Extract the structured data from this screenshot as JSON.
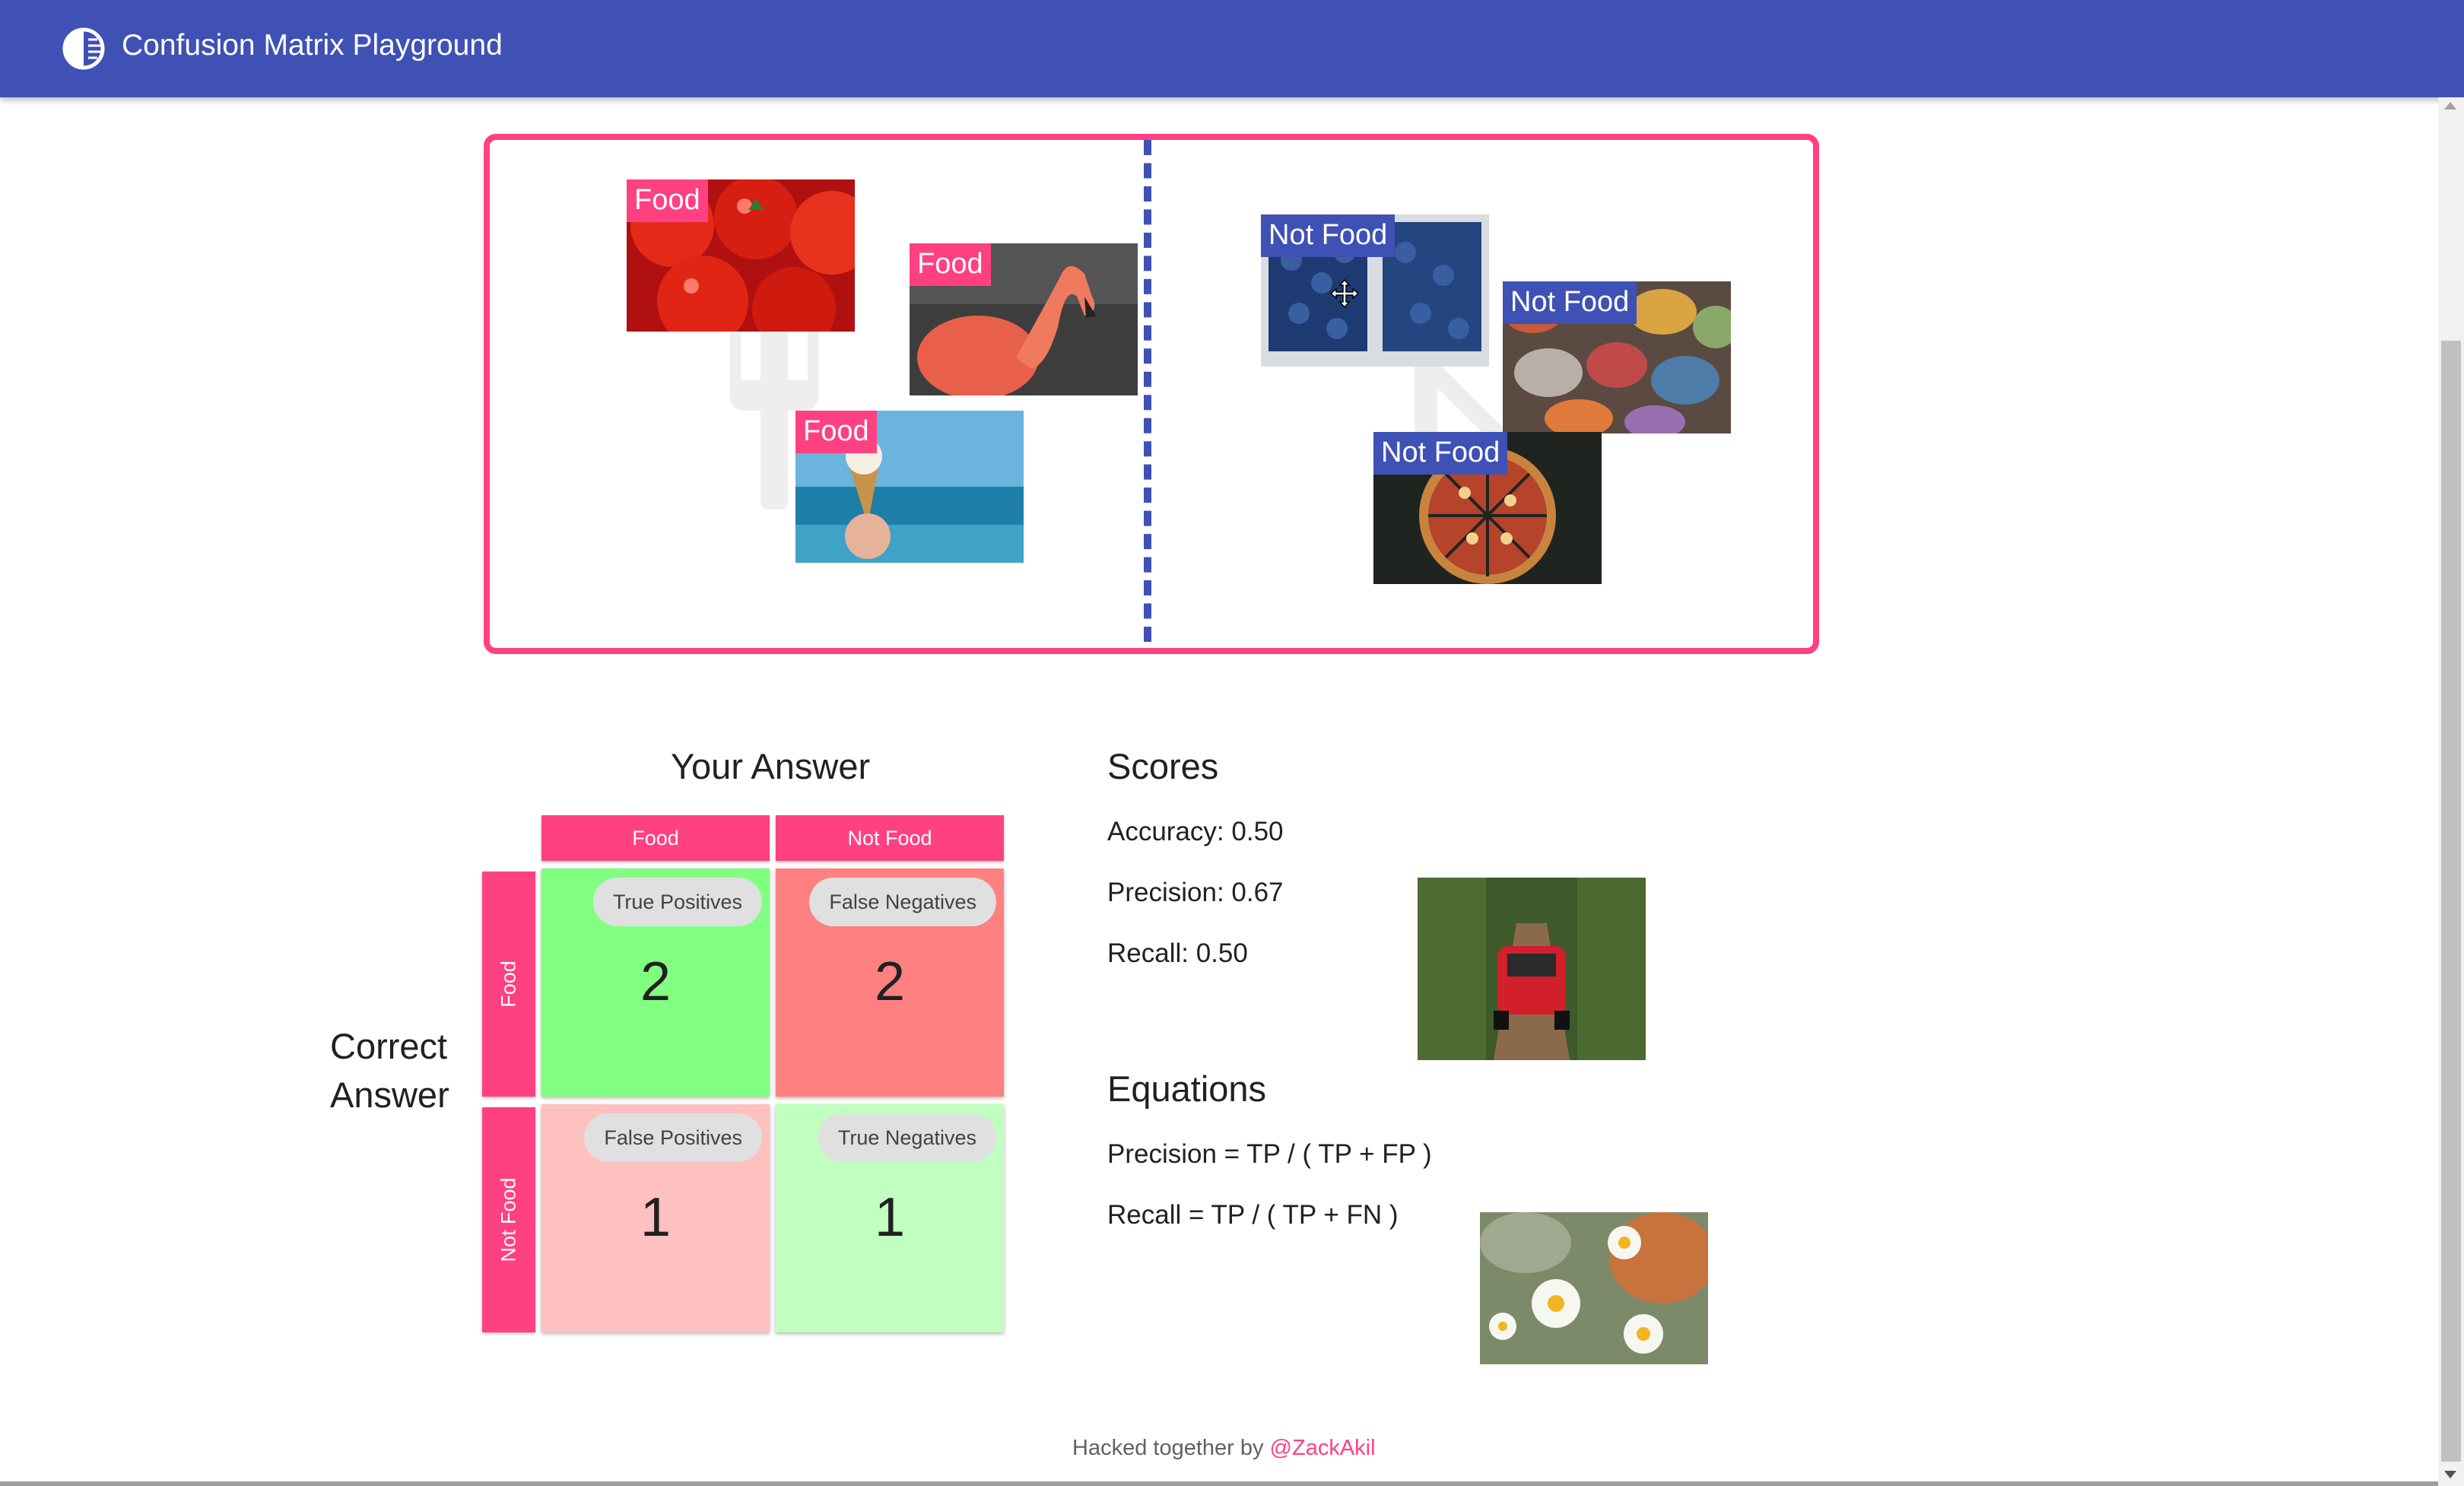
{
  "app": {
    "title": "Confusion Matrix Playground"
  },
  "sorter": {
    "food_cards": [
      {
        "label": "Food",
        "image": "tomatoes"
      },
      {
        "label": "Food",
        "image": "flamingo"
      },
      {
        "label": "Food",
        "image": "ice cream cone"
      }
    ],
    "notfood_cards": [
      {
        "label": "Not Food",
        "image": "blueberries"
      },
      {
        "label": "Not Food",
        "image": "pebbles"
      },
      {
        "label": "Not Food",
        "image": "pizza"
      }
    ]
  },
  "matrix": {
    "your_answer_title": "Your Answer",
    "correct_answer_title": "Correct Answer",
    "columns": [
      "Food",
      "Not Food"
    ],
    "rows": [
      "Food",
      "Not Food"
    ],
    "cells": {
      "tp": {
        "label": "True Positives",
        "value": "2"
      },
      "fn": {
        "label": "False Negatives",
        "value": "2"
      },
      "fp": {
        "label": "False Positives",
        "value": "1"
      },
      "tn": {
        "label": "True Negatives",
        "value": "1"
      }
    },
    "colors": {
      "tp": "#80ff80",
      "fn": "#ff8080",
      "fp": "#ffc0c0",
      "tn": "#c0ffc0",
      "header": "#ff4081"
    }
  },
  "scores": {
    "title": "Scores",
    "accuracy": "Accuracy: 0.50",
    "precision": "Precision: 0.67",
    "recall": "Recall: 0.50"
  },
  "equations": {
    "title": "Equations",
    "precision": "Precision = TP / ( TP + FP )",
    "recall": "Recall = TP / ( TP + FN )"
  },
  "unsorted_images": [
    "red car",
    "daisies"
  ],
  "footer": {
    "prefix": "Hacked together by ",
    "link": "@ZackAkil"
  },
  "colors": {
    "primary": "#3f51b5",
    "accent": "#ff4081"
  }
}
